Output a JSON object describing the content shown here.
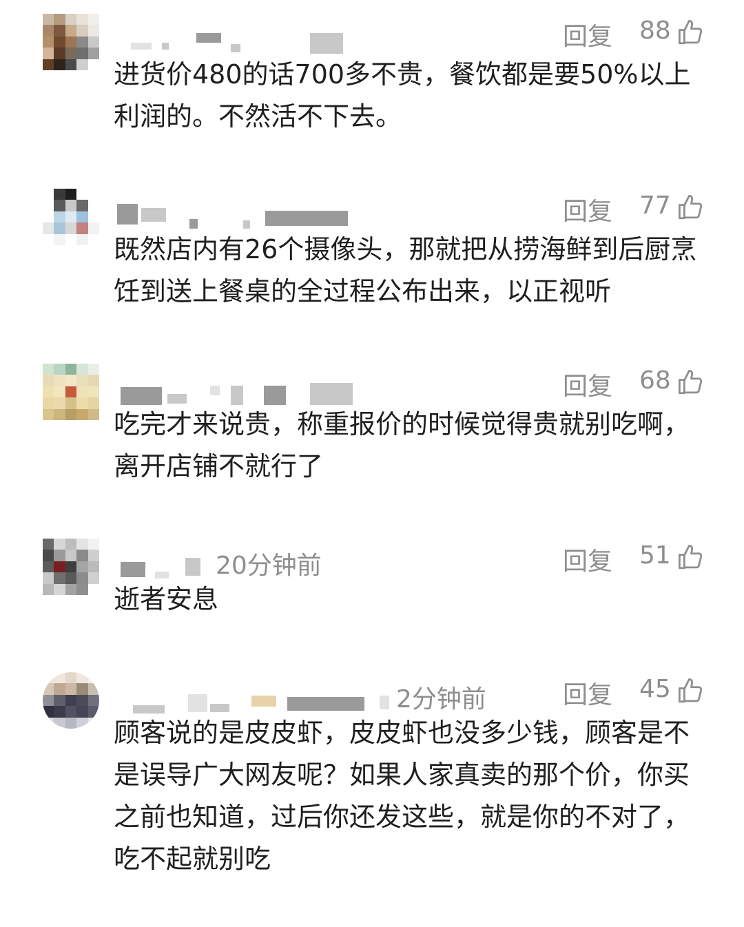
{
  "comments": [
    {
      "time": "",
      "reply_label": "回复",
      "likes": "88",
      "text": "进货价480的话700多不贵，餐饮都是要50%以上利润的。不然活不下去。"
    },
    {
      "time": "",
      "reply_label": "回复",
      "likes": "77",
      "text": "既然店内有26个摄像头，那就把从捞海鲜到后厨烹饪到送上餐桌的全过程公布出来，以正视听"
    },
    {
      "time": "",
      "reply_label": "回复",
      "likes": "68",
      "text": "吃完才来说贵，称重报价的时候觉得贵就别吃啊，离开店铺不就行了"
    },
    {
      "time": "20分钟前",
      "reply_label": "回复",
      "likes": "51",
      "text": "逝者安息"
    },
    {
      "time": "2分钟前",
      "reply_label": "回复",
      "likes": "45",
      "text": "顾客说的是皮皮虾，皮皮虾也没多少钱，顾客是不是误导广大网友呢？如果人家真卖的那个价，你买之前也知道，过后你还发这些，就是你的不对了，吃不起就别吃"
    }
  ],
  "icons": {
    "like": "thumbs-up-icon"
  },
  "colors": {
    "meta": "#8e8e8e",
    "text": "#1f1f1f",
    "background": "#ffffff"
  }
}
